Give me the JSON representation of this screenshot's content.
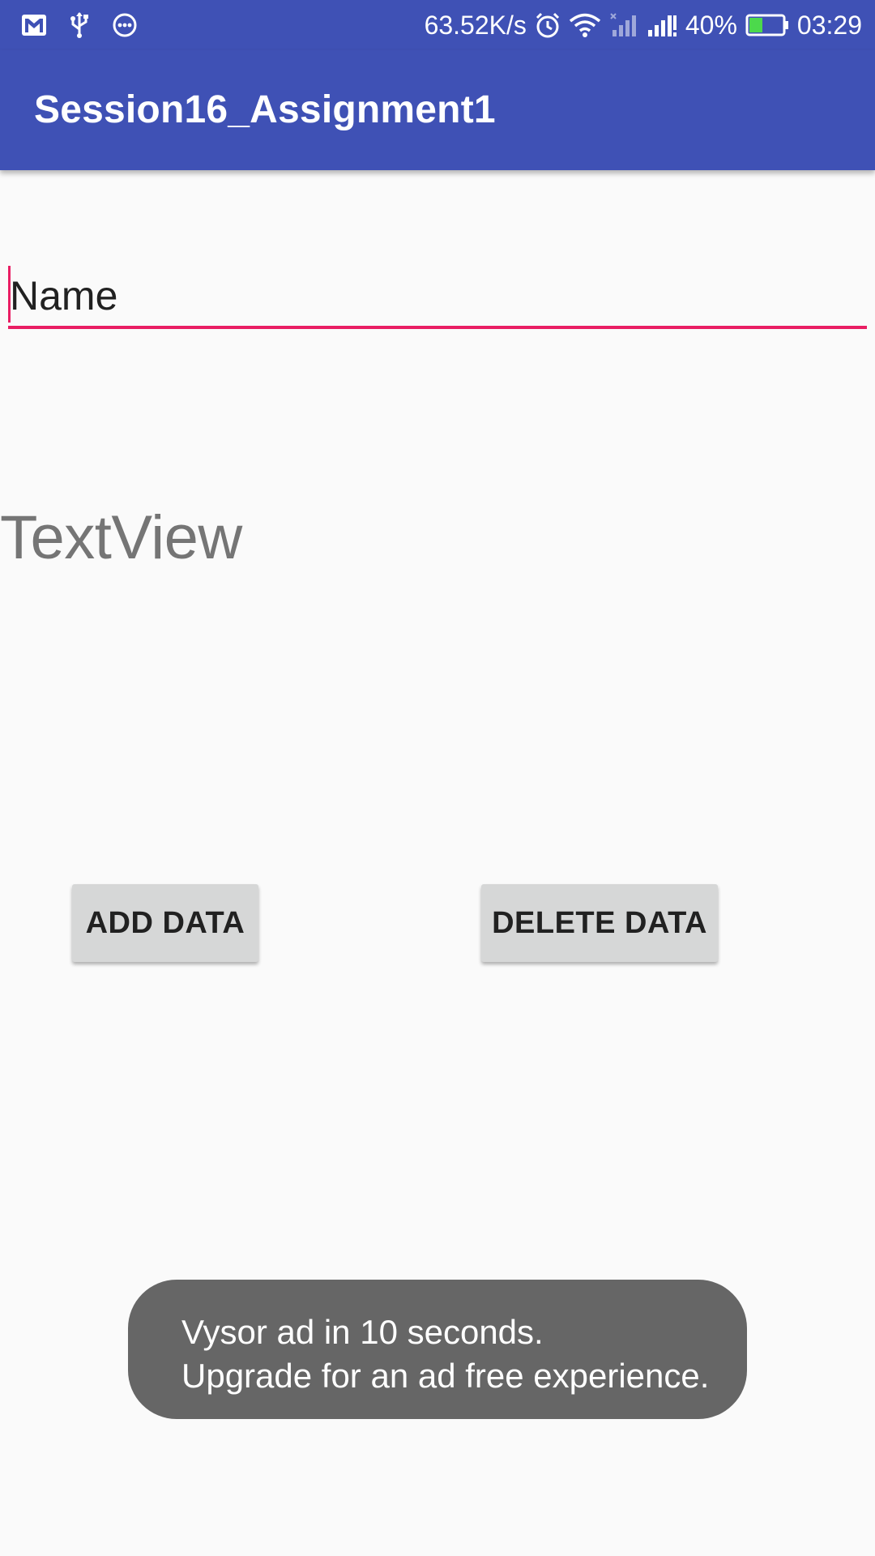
{
  "status_bar": {
    "left_icons": [
      "gmail-icon",
      "usb-icon",
      "more-dots-icon"
    ],
    "network_speed": "63.52K/s",
    "right_icons": [
      "alarm-icon",
      "wifi-icon",
      "signal-no-sim-icon",
      "signal-icon"
    ],
    "battery_percent": "40%",
    "battery_level": 0.4,
    "time": "03:29",
    "colors": {
      "background": "#3f51b5",
      "battery_fill": "#4cd94c"
    }
  },
  "app_bar": {
    "title": "Session16_Assignment1"
  },
  "form": {
    "name_input": {
      "value": "Name"
    },
    "text_view": "TextView",
    "add_button_label": "ADD DATA",
    "delete_button_label": "DELETE DATA"
  },
  "toast": {
    "line1": "Vysor ad in 10 seconds.",
    "line2": "Upgrade for an ad free experience."
  },
  "colors": {
    "accent": "#e91e63",
    "primary": "#3f51b5"
  }
}
